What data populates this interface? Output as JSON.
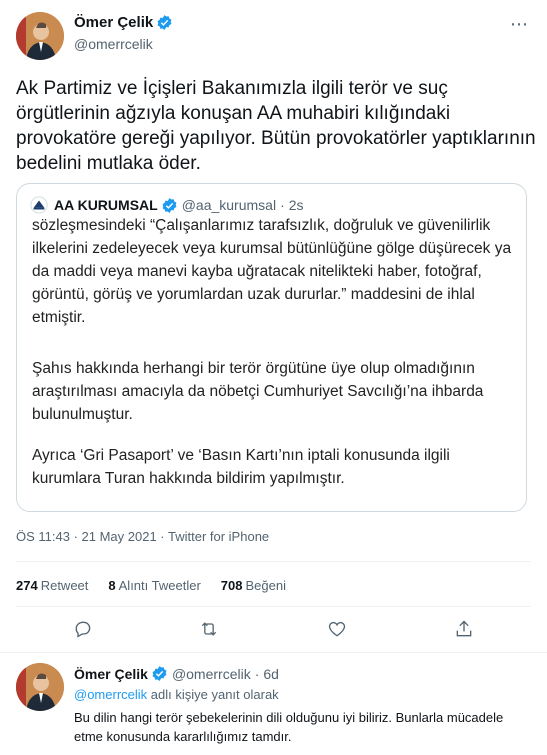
{
  "tweet": {
    "author_name": "Ömer Çelik",
    "author_handle": "@omerrcelik",
    "more_icon": "⋯",
    "text": "Ak Partimiz ve İçişleri Bakanımızla ilgili terör ve suç örgütlerinin ağzıyla konuşan AA muhabiri kılığındaki provokatöre gereği yapılıyor. Bütün provokatörler yaptıklarının bedelini mutlaka öder.",
    "quote": {
      "name": "AA KURUMSAL",
      "handle": "@aa_kurumsal",
      "sep": "·",
      "time": "2s",
      "image_text_1": "sözleşmesindeki “Çalışanlarımız tarafsızlık, doğruluk ve güvenilirlik ilkelerini zedeleyecek veya kurumsal bütünlüğüne gölge düşürecek ya da maddi veya manevi kayba uğratacak nitelikteki haber, fotoğraf, görüntü, görüş ve yorumlardan uzak dururlar.” maddesini de ihlal etmiştir.",
      "image_text_2": "Şahıs hakkında herhangi bir terör örgütüne üye olup olmadığının araştırılması amacıyla da nöbetçi Cumhuriyet Savcılığı’na ihbarda bulunulmuştur.",
      "image_text_3": "Ayrıca ‘Gri Pasaport’ ve ‘Basın Kartı’nın iptali konusunda ilgili kurumlara Turan hakkında bildirim yapılmıştır."
    },
    "timestamp": "ÖS 11:43 · 21 May 2021 · Twitter for iPhone",
    "stats": [
      {
        "count": "274",
        "label": "Retweet"
      },
      {
        "count": "8",
        "label": "Alıntı Tweetler"
      },
      {
        "count": "708",
        "label": "Beğeni"
      }
    ],
    "actions": [
      "reply-icon",
      "retweet-icon",
      "like-icon",
      "share-icon"
    ]
  },
  "reply": {
    "author_name": "Ömer Çelik",
    "author_handle": "@omerrcelik",
    "sep": "·",
    "time": "6d",
    "mention": "@omerrcelik",
    "replying_suffix": "adlı kişiye yanıt olarak",
    "text": "Bu dilin hangi terör şebekelerinin dili olduğunu iyi biliriz. Bunlarla mücadele etme konusunda kararlılığımız tamdır."
  },
  "colors": {
    "accent": "#1d9bf0",
    "secondary_text": "#536471",
    "border": "#cfd9de"
  }
}
